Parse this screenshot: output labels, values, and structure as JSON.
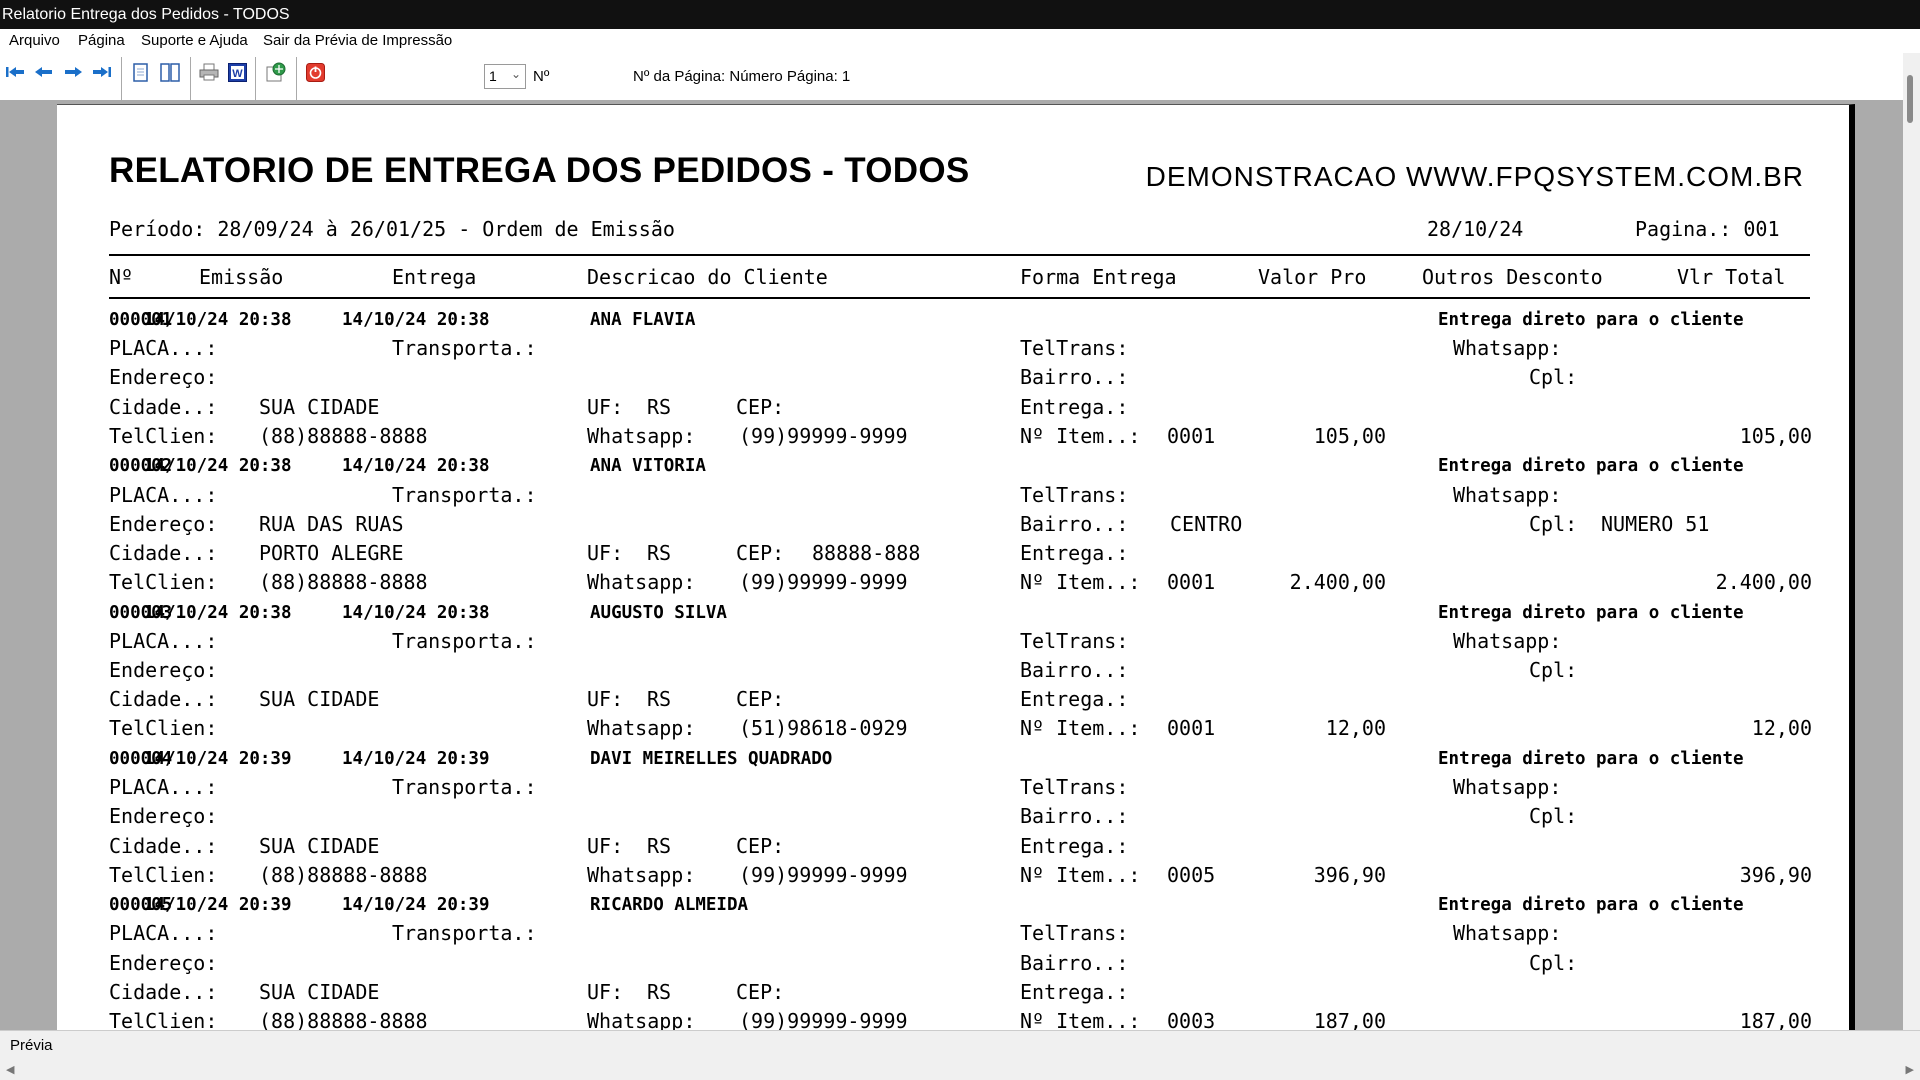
{
  "window": {
    "title": "Relatorio Entrega dos Pedidos - TODOS"
  },
  "menu": [
    "Arquivo",
    "Página",
    "Suporte e Ajuda",
    "Sair da Prévia de Impressão"
  ],
  "toolbar": {
    "page_select": "1",
    "n_label": "Nº",
    "page_info": "Nº da Página: Número Página: 1",
    "icons": [
      "first-page-icon",
      "prev-page-icon",
      "next-page-icon",
      "last-page-icon",
      "single-page-icon",
      "two-page-icon",
      "print-icon",
      "word-export-icon",
      "export-icon",
      "close-preview-icon"
    ]
  },
  "report": {
    "title": "RELATORIO DE ENTREGA DOS PEDIDOS - TODOS",
    "demo": "DEMONSTRACAO WWW.FPQSYSTEM.COM.BR",
    "periodo": "Período: 28/09/24 à 26/01/25 - Ordem de Emissão",
    "date": "28/10/24",
    "pagina": "Pagina.: 001",
    "columns": [
      "Nº",
      "Emissão",
      "Entrega",
      "Descricao do Cliente",
      "Forma Entrega",
      "Valor Pro",
      "Outros Desconto",
      "Vlr Total"
    ],
    "labels": {
      "placa": "PLACA...:",
      "transporta": "Transporta.:",
      "teltrans": "TelTrans:",
      "whatsapp": "Whatsapp:",
      "endereco": "Endereço:",
      "bairro": "Bairro..:",
      "cpl": "Cpl:",
      "cidade": "Cidade..:",
      "uf": "UF:",
      "cep": "CEP:",
      "entrega": "Entrega.:",
      "telclien": "TelClien:",
      "whats2": "Whatsapp:",
      "item": "Nº Item..:"
    },
    "orders": [
      {
        "num": "000001",
        "emissao": "14/10/24 20:38",
        "entrega": "14/10/24 20:38",
        "cliente": "ANA FLAVIA",
        "forma": "Entrega direto para o cliente",
        "endereco": "",
        "bairro": "",
        "cpl": "",
        "cidade": "SUA CIDADE",
        "uf": "RS",
        "cep": "",
        "telclien": "(88)88888-8888",
        "whatsapp": "(99)99999-9999",
        "item": "0001",
        "valor": "105,00",
        "total": "105,00"
      },
      {
        "num": "000002",
        "emissao": "14/10/24 20:38",
        "entrega": "14/10/24 20:38",
        "cliente": "ANA VITORIA",
        "forma": "Entrega direto para o cliente",
        "endereco": "RUA DAS RUAS",
        "bairro": "CENTRO",
        "cpl": "NUMERO 51",
        "cidade": "PORTO ALEGRE",
        "uf": "RS",
        "cep": "88888-888",
        "telclien": "(88)88888-8888",
        "whatsapp": "(99)99999-9999",
        "item": "0001",
        "valor": "2.400,00",
        "total": "2.400,00"
      },
      {
        "num": "000003",
        "emissao": "14/10/24 20:38",
        "entrega": "14/10/24 20:38",
        "cliente": "AUGUSTO SILVA",
        "forma": "Entrega direto para o cliente",
        "endereco": "",
        "bairro": "",
        "cpl": "",
        "cidade": "SUA CIDADE",
        "uf": "RS",
        "cep": "",
        "telclien": "",
        "whatsapp": "(51)98618-0929",
        "item": "0001",
        "valor": "12,00",
        "total": "12,00"
      },
      {
        "num": "000004",
        "emissao": "14/10/24 20:39",
        "entrega": "14/10/24 20:39",
        "cliente": "DAVI MEIRELLES QUADRADO",
        "forma": "Entrega direto para o cliente",
        "endereco": "",
        "bairro": "",
        "cpl": "",
        "cidade": "SUA CIDADE",
        "uf": "RS",
        "cep": "",
        "telclien": "(88)88888-8888",
        "whatsapp": "(99)99999-9999",
        "item": "0005",
        "valor": "396,90",
        "total": "396,90"
      },
      {
        "num": "000005",
        "emissao": "14/10/24 20:39",
        "entrega": "14/10/24 20:39",
        "cliente": "RICARDO ALMEIDA",
        "forma": "Entrega direto para o cliente",
        "endereco": "",
        "bairro": "",
        "cpl": "",
        "cidade": "SUA CIDADE",
        "uf": "RS",
        "cep": "",
        "telclien": "(88)88888-8888",
        "whatsapp": "(99)99999-9999",
        "item": "0003",
        "valor": "187,00",
        "total": "187,00"
      }
    ]
  },
  "status": {
    "text": "Prévia"
  }
}
